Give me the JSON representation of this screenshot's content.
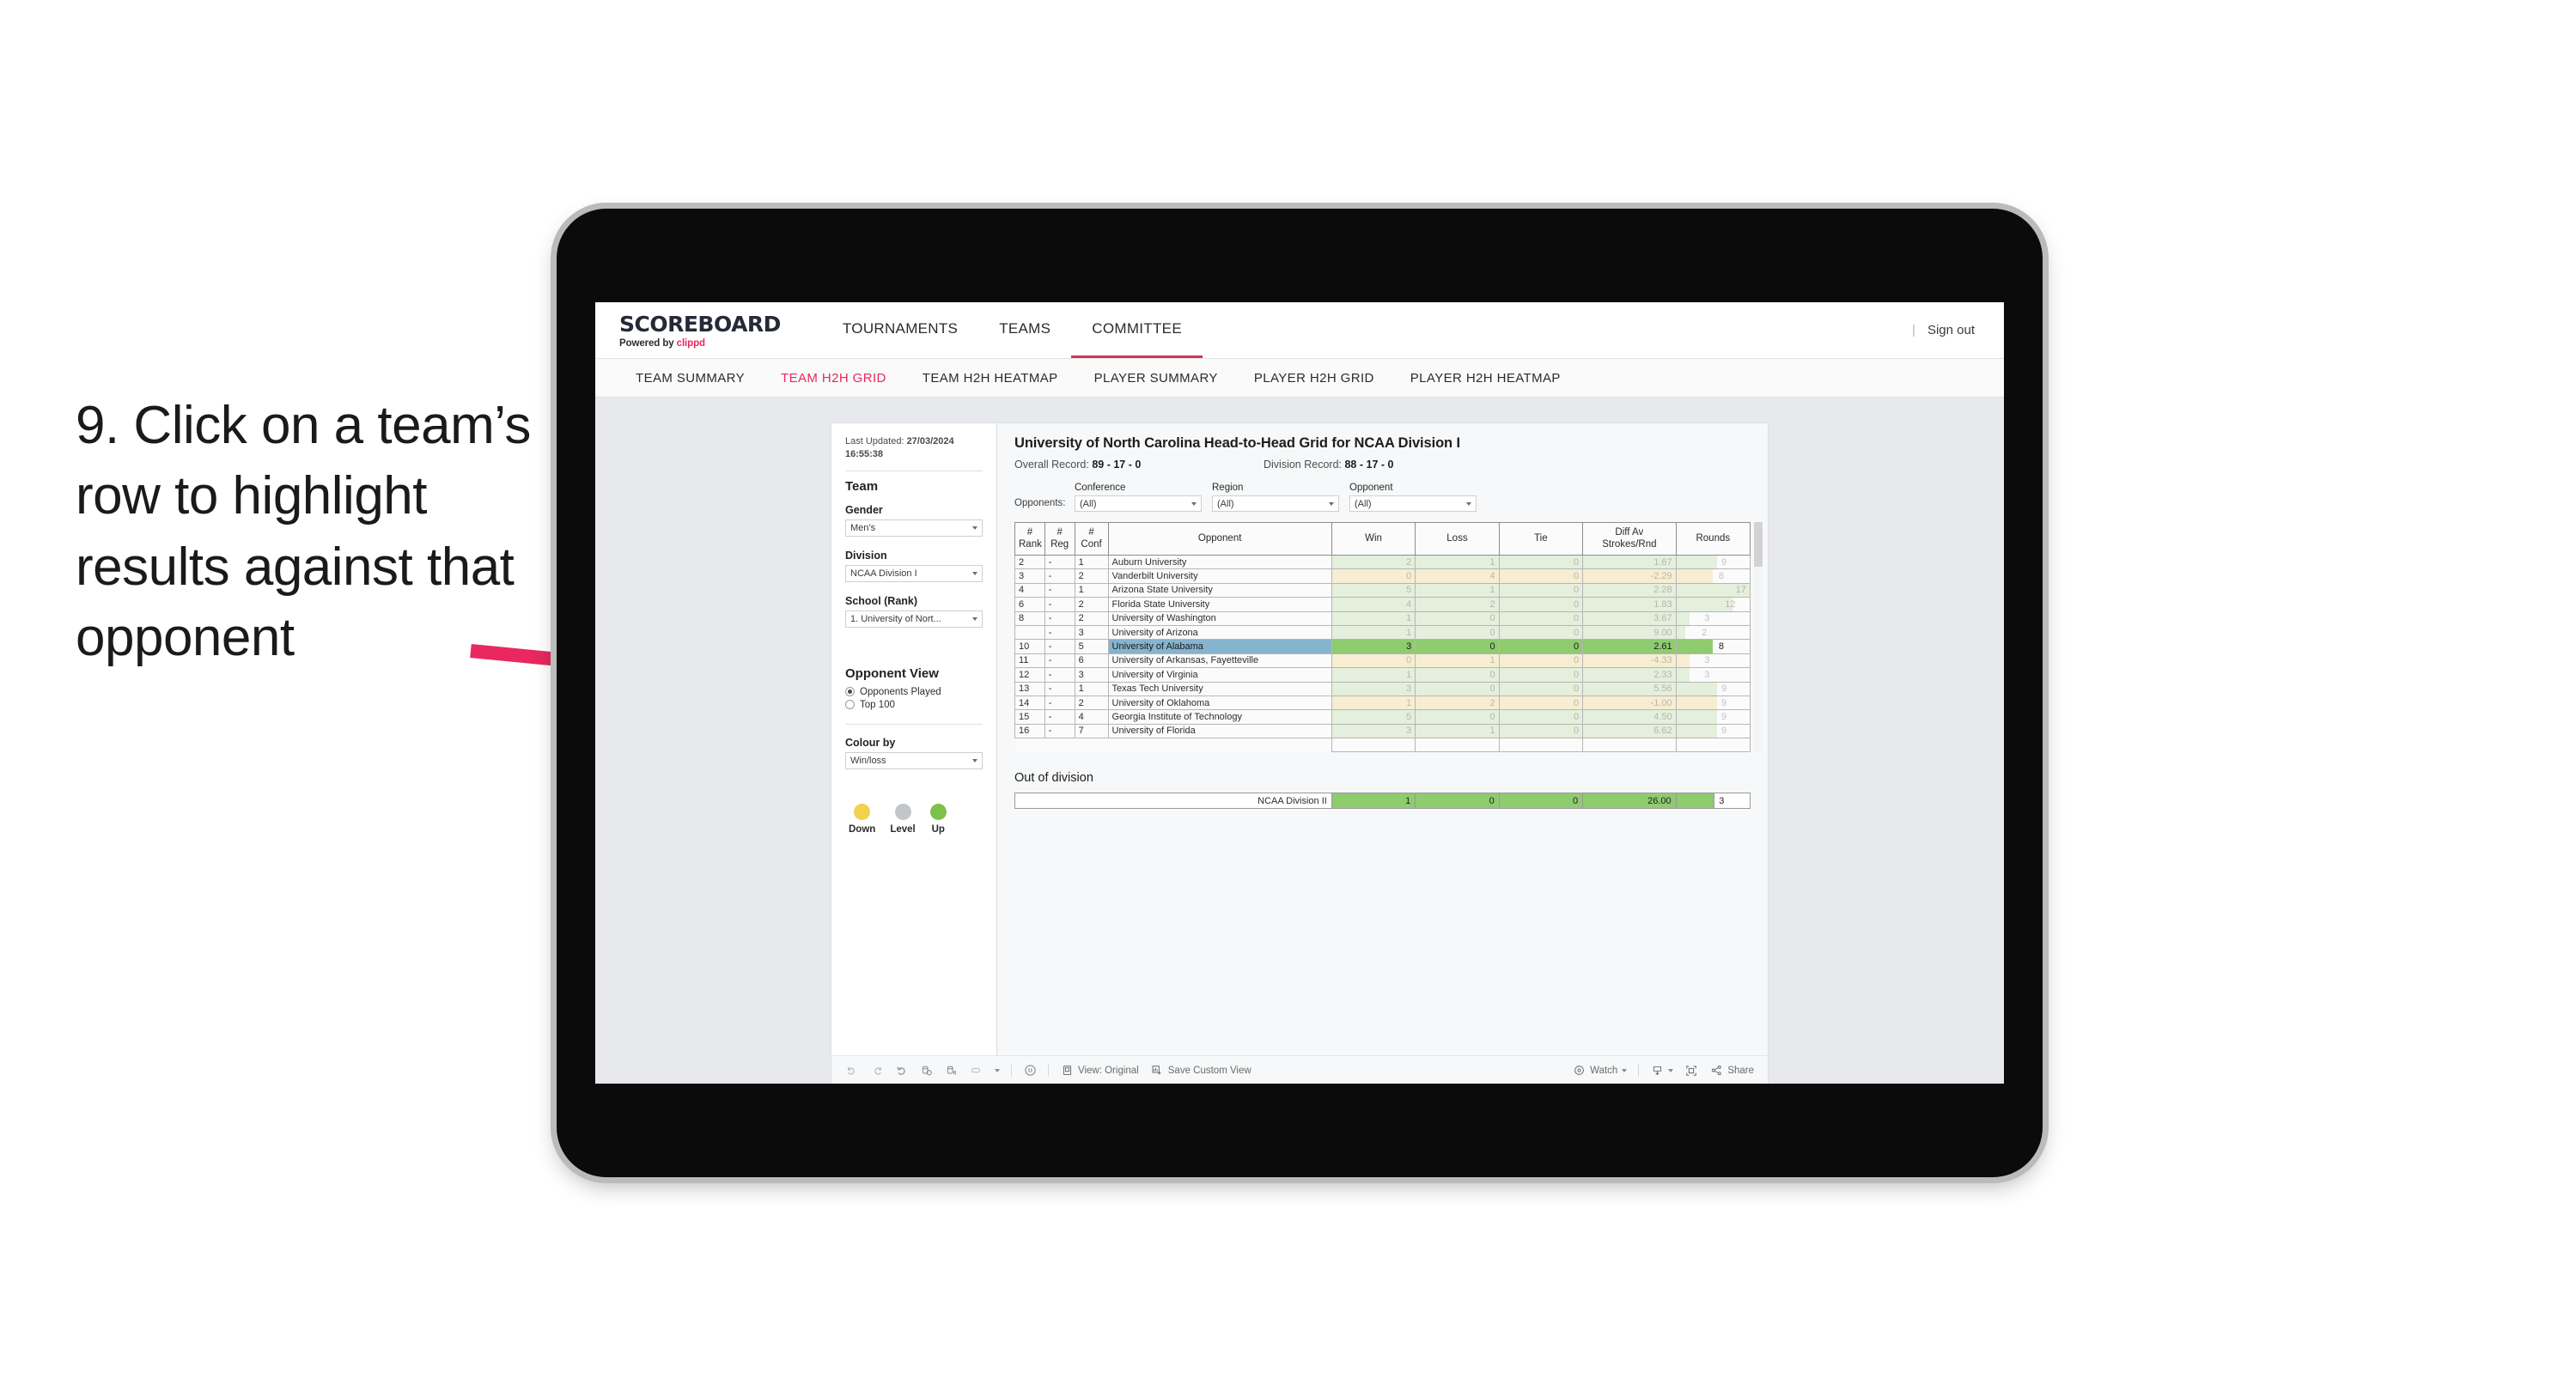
{
  "annotation": {
    "text": "9. Click on a team’s row to highlight results against that opponent",
    "arrow_color": "#e8285e"
  },
  "app": {
    "brand_name": "SCOREBOARD",
    "brand_sub_prefix": "Powered by ",
    "brand_sub_clippd": "clippd",
    "nav": [
      {
        "label": "TOURNAMENTS",
        "active": false
      },
      {
        "label": "TEAMS",
        "active": false
      },
      {
        "label": "COMMITTEE",
        "active": true
      }
    ],
    "sign_out": "Sign out",
    "sub_nav": [
      {
        "label": "TEAM SUMMARY",
        "active": false
      },
      {
        "label": "TEAM H2H GRID",
        "active": true
      },
      {
        "label": "TEAM H2H HEATMAP",
        "active": false
      },
      {
        "label": "PLAYER SUMMARY",
        "active": false
      },
      {
        "label": "PLAYER H2H GRID",
        "active": false
      },
      {
        "label": "PLAYER H2H HEATMAP",
        "active": false
      }
    ]
  },
  "sidebar": {
    "last_updated_label": "Last Updated: ",
    "last_updated_value": "27/03/2024 16:55:38",
    "team_heading": "Team",
    "gender_label": "Gender",
    "gender_value": "Men’s",
    "division_label": "Division",
    "division_value": "NCAA Division I",
    "school_label": "School (Rank)",
    "school_value": "1. University of Nort...",
    "opponent_view_heading": "Opponent View",
    "opponent_view_options": [
      {
        "label": "Opponents Played",
        "checked": true
      },
      {
        "label": "Top 100",
        "checked": false
      }
    ],
    "colour_by_label": "Colour by",
    "colour_by_value": "Win/loss",
    "legend": [
      {
        "label": "Down",
        "color": "#f2d14e"
      },
      {
        "label": "Level",
        "color": "#c3c6c8"
      },
      {
        "label": "Up",
        "color": "#7cc24a"
      }
    ]
  },
  "viz": {
    "title": "University of North Carolina Head-to-Head Grid for NCAA Division I",
    "overall_record_label": "Overall Record: ",
    "overall_record_value": "89 - 17 - 0",
    "division_record_label": "Division Record: ",
    "division_record_value": "88 - 17 - 0",
    "opponents_label": "Opponents:",
    "filters": [
      {
        "label": "Conference",
        "value": "(All)"
      },
      {
        "label": "Region",
        "value": "(All)"
      },
      {
        "label": "Opponent",
        "value": "(All)"
      }
    ],
    "columns": [
      "# Rank",
      "# Reg",
      "# Conf",
      "Opponent",
      "Win",
      "Loss",
      "Tie",
      "Diff Av Strokes/Rnd",
      "Rounds"
    ],
    "rows": [
      {
        "rank": "2",
        "reg": "-",
        "conf": "1",
        "opponent": "Auburn University",
        "win": "2",
        "loss": "1",
        "tie": "0",
        "diff": "1.67",
        "rounds": "9",
        "tone": "up",
        "selected": false,
        "bar": 0.56
      },
      {
        "rank": "3",
        "reg": "-",
        "conf": "2",
        "opponent": "Vanderbilt University",
        "win": "0",
        "loss": "4",
        "tie": "0",
        "diff": "-2.29",
        "rounds": "8",
        "tone": "down",
        "selected": false,
        "bar": 0.5
      },
      {
        "rank": "4",
        "reg": "-",
        "conf": "1",
        "opponent": "Arizona State University",
        "win": "5",
        "loss": "1",
        "tie": "0",
        "diff": "2.28",
        "rounds": "17",
        "tone": "up",
        "selected": false,
        "bar": 1.0
      },
      {
        "rank": "6",
        "reg": "-",
        "conf": "2",
        "opponent": "Florida State University",
        "win": "4",
        "loss": "2",
        "tie": "0",
        "diff": "1.83",
        "rounds": "12",
        "tone": "up",
        "selected": false,
        "bar": 0.76
      },
      {
        "rank": "8",
        "reg": "-",
        "conf": "2",
        "opponent": "University of Washington",
        "win": "1",
        "loss": "0",
        "tie": "0",
        "diff": "3.67",
        "rounds": "3",
        "tone": "up",
        "selected": false,
        "bar": 0.18
      },
      {
        "rank": "",
        "reg": "-",
        "conf": "3",
        "opponent": "University of Arizona",
        "win": "1",
        "loss": "0",
        "tie": "0",
        "diff": "9.00",
        "rounds": "2",
        "tone": "up",
        "selected": false,
        "bar": 0.12
      },
      {
        "rank": "10",
        "reg": "-",
        "conf": "5",
        "opponent": "University of Alabama",
        "win": "3",
        "loss": "0",
        "tie": "0",
        "diff": "2.61",
        "rounds": "8",
        "tone": "up",
        "selected": true,
        "bar": 0.5
      },
      {
        "rank": "11",
        "reg": "-",
        "conf": "6",
        "opponent": "University of Arkansas, Fayetteville",
        "win": "0",
        "loss": "1",
        "tie": "0",
        "diff": "-4.33",
        "rounds": "3",
        "tone": "down",
        "selected": false,
        "bar": 0.18
      },
      {
        "rank": "12",
        "reg": "-",
        "conf": "3",
        "opponent": "University of Virginia",
        "win": "1",
        "loss": "0",
        "tie": "0",
        "diff": "2.33",
        "rounds": "3",
        "tone": "up",
        "selected": false,
        "bar": 0.18
      },
      {
        "rank": "13",
        "reg": "-",
        "conf": "1",
        "opponent": "Texas Tech University",
        "win": "3",
        "loss": "0",
        "tie": "0",
        "diff": "5.56",
        "rounds": "9",
        "tone": "up",
        "selected": false,
        "bar": 0.56
      },
      {
        "rank": "14",
        "reg": "-",
        "conf": "2",
        "opponent": "University of Oklahoma",
        "win": "1",
        "loss": "2",
        "tie": "0",
        "diff": "-1.00",
        "rounds": "9",
        "tone": "down",
        "selected": false,
        "bar": 0.56
      },
      {
        "rank": "15",
        "reg": "-",
        "conf": "4",
        "opponent": "Georgia Institute of Technology",
        "win": "5",
        "loss": "0",
        "tie": "0",
        "diff": "4.50",
        "rounds": "9",
        "tone": "up",
        "selected": false,
        "bar": 0.56
      },
      {
        "rank": "16",
        "reg": "-",
        "conf": "7",
        "opponent": "University of Florida",
        "win": "3",
        "loss": "1",
        "tie": "0",
        "diff": "6.62",
        "rounds": "9",
        "tone": "up",
        "selected": false,
        "bar": 0.56
      }
    ],
    "out_of_division": {
      "title": "Out of division",
      "row": {
        "label": "NCAA Division II",
        "win": "1",
        "loss": "0",
        "tie": "0",
        "diff": "26.00",
        "rounds": "3"
      }
    },
    "toolbar": {
      "view_label": "View: Original",
      "save_label": "Save Custom View",
      "watch_label": "Watch",
      "share_label": "Share"
    }
  }
}
